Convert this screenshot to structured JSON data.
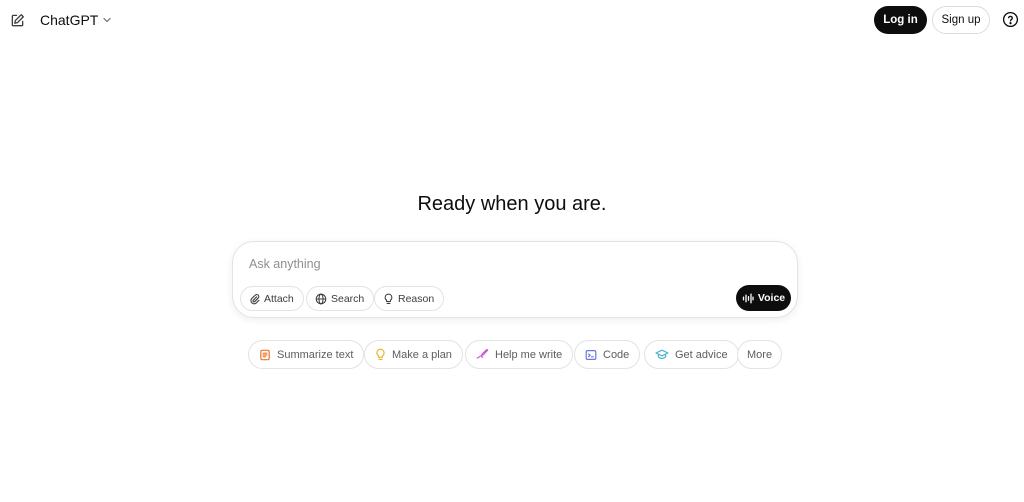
{
  "header": {
    "model_name": "ChatGPT",
    "login_label": "Log in",
    "signup_label": "Sign up"
  },
  "main": {
    "headline": "Ready when you are."
  },
  "composer": {
    "placeholder": "Ask anything",
    "value": "",
    "tools": [
      {
        "label": "Attach",
        "icon": "paperclip-icon"
      },
      {
        "label": "Search",
        "icon": "globe-icon"
      },
      {
        "label": "Reason",
        "icon": "lightbulb-icon"
      }
    ],
    "voice_label": "Voice"
  },
  "suggestions": [
    {
      "label": "Summarize text",
      "icon": "document-icon",
      "color": "#e8762e"
    },
    {
      "label": "Make a plan",
      "icon": "lightbulb-icon",
      "color": "#e9b836"
    },
    {
      "label": "Help me write",
      "icon": "pen-icon",
      "color": "#c95bd3"
    },
    {
      "label": "Code",
      "icon": "terminal-icon",
      "color": "#6b7bd8"
    },
    {
      "label": "Get advice",
      "icon": "graduation-cap-icon",
      "color": "#4bb3cf"
    },
    {
      "label": "More",
      "icon": "",
      "color": ""
    }
  ],
  "colors": {
    "primary_button": "#0d0d0d",
    "border": "#e3e3e3",
    "placeholder": "#8f8f8f"
  }
}
